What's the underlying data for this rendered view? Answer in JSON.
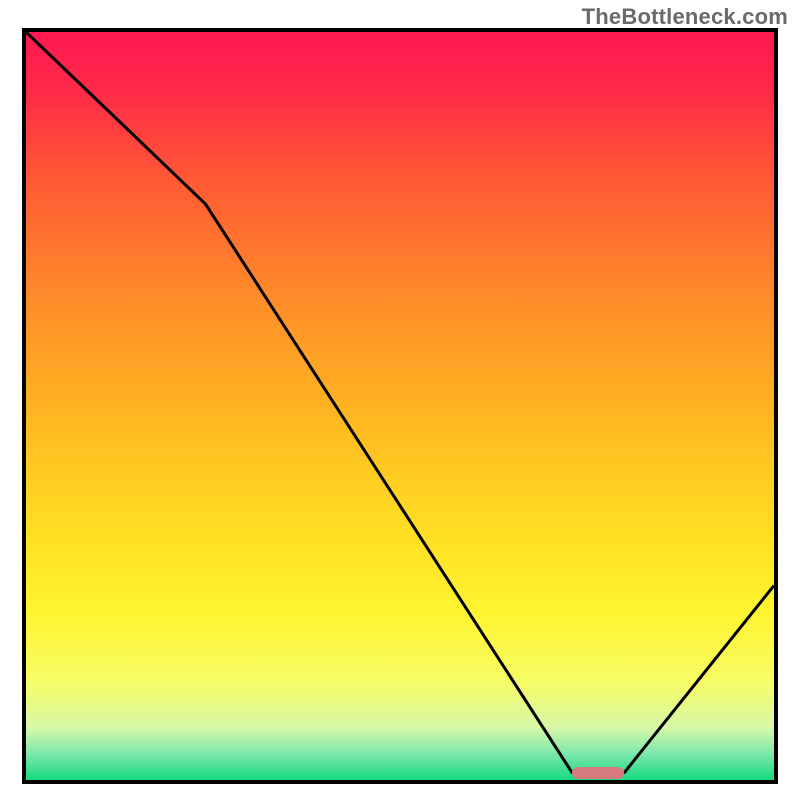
{
  "attribution": "TheBottleneck.com",
  "chart_data": {
    "type": "line",
    "title": "",
    "xlabel": "",
    "ylabel": "",
    "xlim": [
      0,
      100
    ],
    "ylim": [
      0,
      100
    ],
    "series": [
      {
        "name": "bottleneck-curve",
        "x": [
          0,
          24,
          73,
          80,
          100
        ],
        "values": [
          100,
          77,
          1,
          1,
          26
        ]
      }
    ],
    "annotations": [
      {
        "name": "optimal-range",
        "x_start": 73,
        "x_end": 80,
        "y": 1
      }
    ],
    "background_gradient_stops": [
      {
        "offset": 0.0,
        "color": "#ff1952"
      },
      {
        "offset": 0.08,
        "color": "#ff2a48"
      },
      {
        "offset": 0.2,
        "color": "#ff5a34"
      },
      {
        "offset": 0.35,
        "color": "#ff8a2a"
      },
      {
        "offset": 0.5,
        "color": "#ffb321"
      },
      {
        "offset": 0.65,
        "color": "#ffda22"
      },
      {
        "offset": 0.78,
        "color": "#fff531"
      },
      {
        "offset": 0.87,
        "color": "#f6fc67"
      },
      {
        "offset": 0.93,
        "color": "#d7f8a8"
      },
      {
        "offset": 0.965,
        "color": "#7de8ac"
      },
      {
        "offset": 1.0,
        "color": "#17d980"
      }
    ]
  }
}
